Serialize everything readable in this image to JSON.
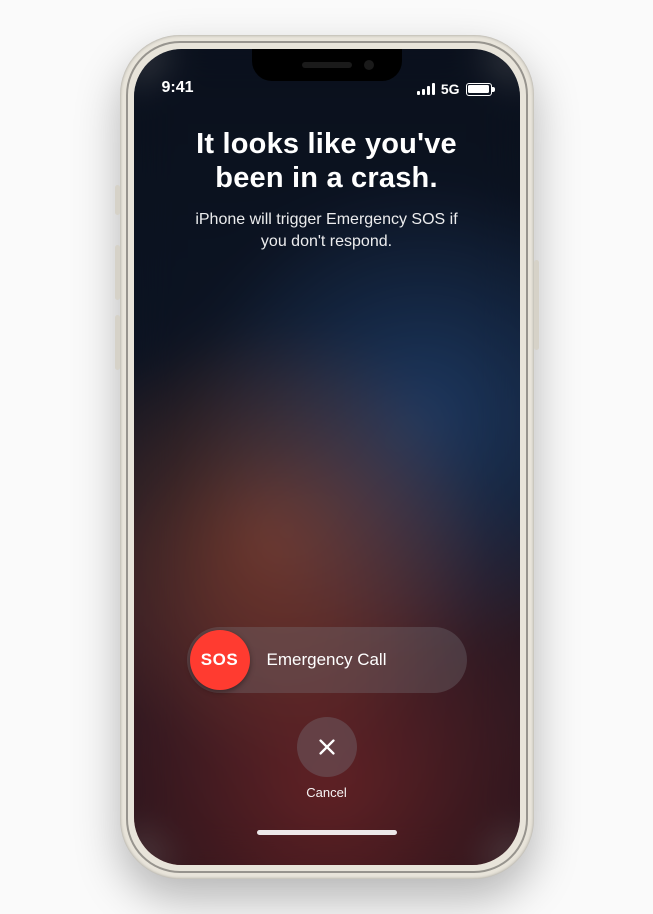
{
  "status": {
    "time": "9:41",
    "network": "5G"
  },
  "headline": {
    "title": "It looks like you've been in a crash.",
    "subtitle": "iPhone will trigger Emergency SOS if you don't respond."
  },
  "slider": {
    "knob_label": "SOS",
    "track_label": "Emergency Call"
  },
  "cancel": {
    "label": "Cancel"
  }
}
